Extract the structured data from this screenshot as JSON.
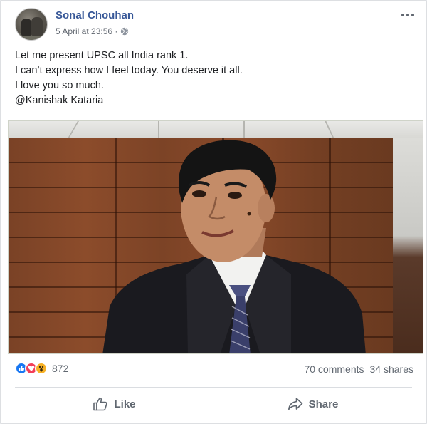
{
  "post": {
    "author": "Sonal Chouhan",
    "timestamp": "5 April at 23:56 ·",
    "privacy_icon": "globe-icon",
    "text_lines": [
      "Let me present UPSC all India rank 1.",
      "I can’t express how I feel today. You deserve it all.",
      "I love you so much.",
      "@Kanishak Kataria"
    ]
  },
  "stats": {
    "reaction_icons": [
      "like-icon",
      "love-icon",
      "wow-icon"
    ],
    "reaction_count": "872",
    "comments": "70 comments",
    "shares": "34 shares"
  },
  "actions": {
    "like_label": "Like",
    "share_label": "Share"
  },
  "colors": {
    "author": "#385898",
    "like": "#1877f2",
    "love": "#f33e58",
    "wow": "#f7b125"
  }
}
